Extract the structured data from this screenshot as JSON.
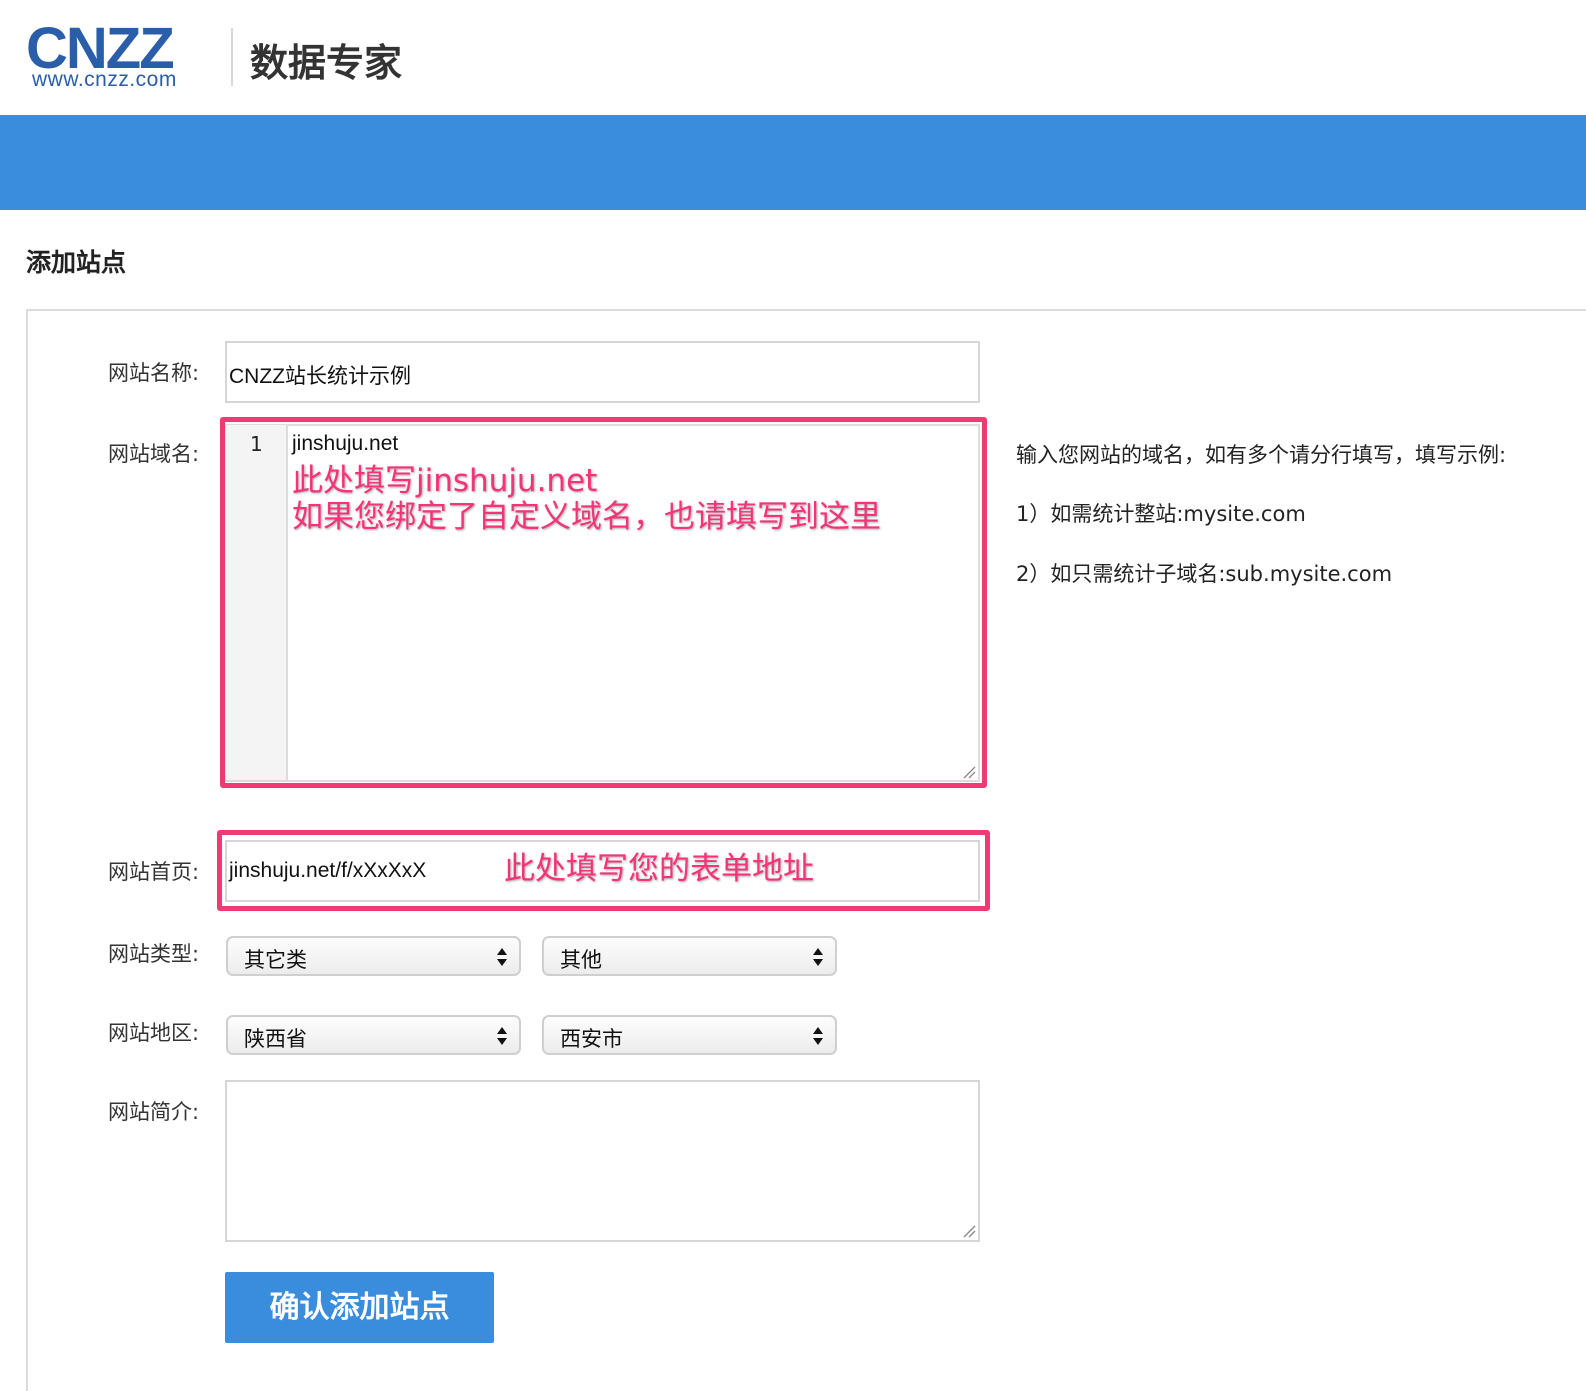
{
  "header": {
    "logo_text": "CNZZ",
    "logo_url": "www.cnzz.com",
    "product": "数据专家"
  },
  "page": {
    "title": "添加站点"
  },
  "form": {
    "site_name": {
      "label": "网站名称:",
      "value": "CNZZ站长统计示例"
    },
    "domain": {
      "label": "网站域名:",
      "line_number": "1",
      "value": "jinshuju.net",
      "annotation_line1": "此处填写jinshuju.net",
      "annotation_line2": "如果您绑定了自定义域名，也请填写到这里",
      "help": [
        "输入您网站的域名，如有多个请分行填写，填写示例:",
        "1）如需统计整站:mysite.com",
        "2）如只需统计子域名:sub.mysite.com"
      ]
    },
    "homepage": {
      "label": "网站首页:",
      "value": "jinshuju.net/f/xXxXxX",
      "annotation": "此处填写您的表单地址"
    },
    "type": {
      "label": "网站类型:",
      "select1": "其它类",
      "select2": "其他"
    },
    "region": {
      "label": "网站地区:",
      "select1": "陕西省",
      "select2": "西安市"
    },
    "intro": {
      "label": "网站简介:",
      "value": ""
    },
    "submit_label": "确认添加站点"
  },
  "colors": {
    "brand_blue": "#3a8ddd",
    "logo_blue": "#2b5ea8",
    "annotation_pink": "#f03a73"
  }
}
